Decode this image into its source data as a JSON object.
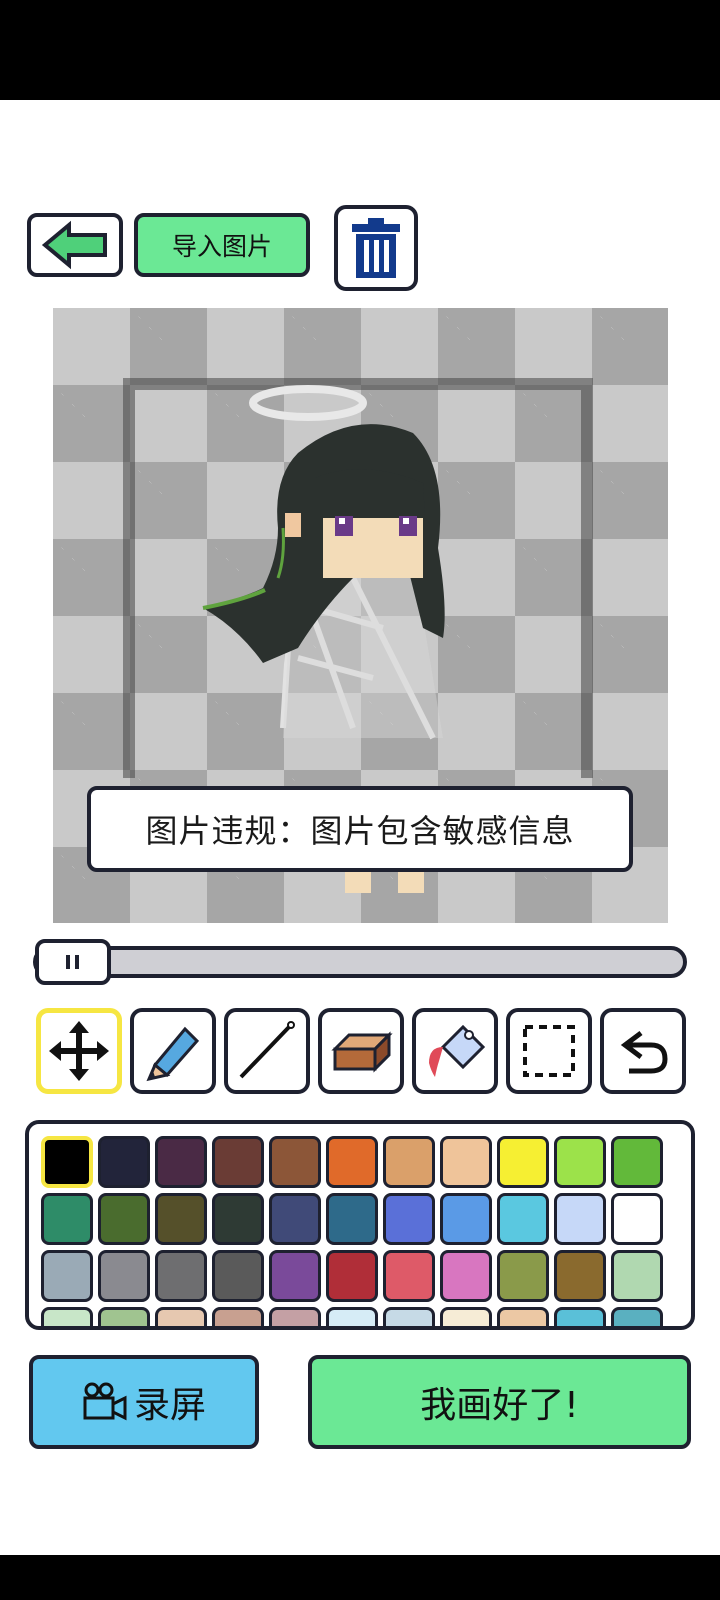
{
  "toolbar": {
    "back_icon": "back-arrow-icon",
    "import_label": "导入图片",
    "trash_icon": "trash-icon"
  },
  "canvas": {
    "toast_message": "图片违规：图片包含敏感信息"
  },
  "slider": {
    "thumb_icon": "pause-icon"
  },
  "tools": [
    {
      "name": "move",
      "icon": "move-arrows-icon",
      "selected": true
    },
    {
      "name": "pencil",
      "icon": "pencil-icon",
      "selected": false
    },
    {
      "name": "line",
      "icon": "line-icon",
      "selected": false
    },
    {
      "name": "eraser",
      "icon": "eraser-icon",
      "selected": false
    },
    {
      "name": "fill",
      "icon": "paint-bucket-icon",
      "selected": false
    },
    {
      "name": "select",
      "icon": "selection-icon",
      "selected": false
    },
    {
      "name": "undo",
      "icon": "undo-icon",
      "selected": false
    }
  ],
  "palette": {
    "selected_index": 0,
    "colors": [
      "#000000",
      "#22243a",
      "#4a2a45",
      "#6a3c35",
      "#8c5638",
      "#e06a2a",
      "#daa06a",
      "#efc49a",
      "#f6ef32",
      "#9ce24a",
      "#62b93a",
      "#2e8c68",
      "#4a6c2e",
      "#55502a",
      "#2e3a34",
      "#404a78",
      "#2e6a8a",
      "#5a70d8",
      "#5a9ae6",
      "#5ac8e0",
      "#c6d8f8",
      "#ffffff",
      "#9aaab6",
      "#8a8a90",
      "#6e6e70",
      "#5a5a5a",
      "#7a4a9a",
      "#b02e38",
      "#de5a68",
      "#d876c0",
      "#8a9a4a",
      "#8a6a2e",
      "#b0d8b0",
      "#c8e6c8",
      "#a0c490",
      "#e6c8b0",
      "#c8a090",
      "#c4a0a4",
      "#d6ecf6",
      "#c6dae6",
      "#f6ecd6",
      "#ecc8a4",
      "#5ac0d8",
      "#5ab0c0"
    ]
  },
  "actions": {
    "record_label": "录屏",
    "record_icon": "camera-icon",
    "done_label": "我画好了!"
  }
}
